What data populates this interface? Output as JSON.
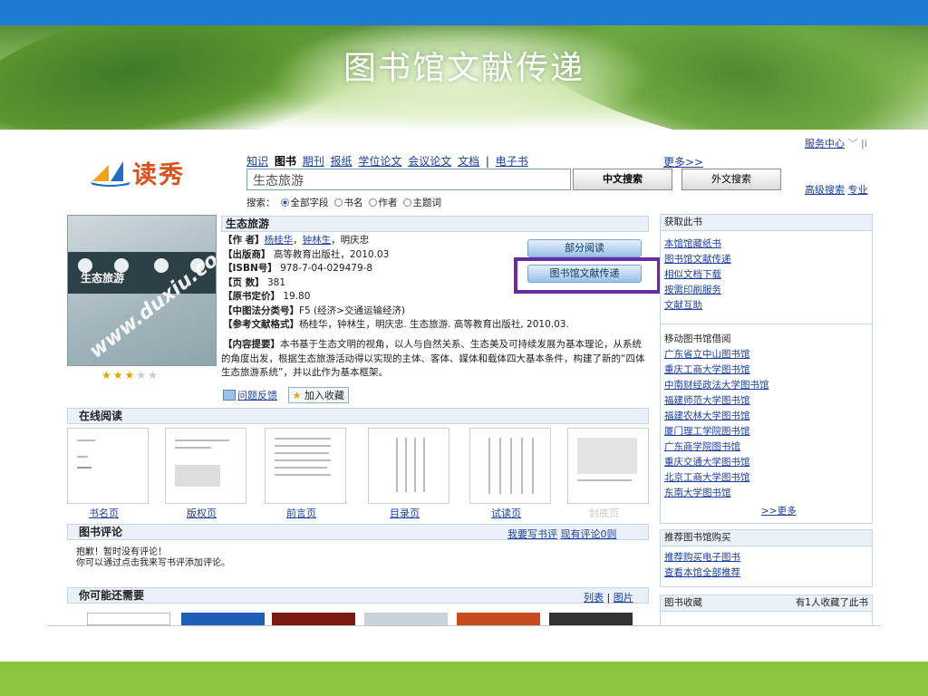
{
  "slide": {
    "title": "图书馆文献传递"
  },
  "header": {
    "logo_text": "读秀",
    "service_center": "服务中心",
    "service_extra": "|i",
    "nav": [
      "知识",
      "图书",
      "期刊",
      "报纸",
      "学位论文",
      "会议论文",
      "文档",
      "电子书"
    ],
    "nav_sep": "|",
    "more": "更多>>",
    "search_value": "生态旅游",
    "cn_search": "中文搜索",
    "foreign_search": "外文搜索",
    "advanced_search": "高级搜索",
    "professional_search": "专业",
    "search_label": "搜索：",
    "radio_options": [
      "全部字段",
      "书名",
      "作者",
      "主题词"
    ],
    "radio_selected": "全部字段"
  },
  "book": {
    "title": "生态旅游",
    "cover_title": "生态旅游",
    "cover_watermark": "www.duxiu.com",
    "author_label": "【作  者】",
    "authors": [
      "杨桂华",
      "钟林生"
    ],
    "author_rest": "，明庆忠",
    "publisher_label": "【出版商】",
    "publisher": "高等教育出版社，2010.03",
    "isbn_label": "【ISBN号】",
    "isbn": "978-7-04-029479-8",
    "pages_label": "【页  数】",
    "pages": "381",
    "price_label": "【原书定价】",
    "price": "19.80",
    "clc_label": "【中图法分类号】",
    "clc": "F5 (经济>交通运输经济)",
    "ref_label": "【参考文献格式】",
    "ref": "杨桂华，钟林生，明庆忠. 生态旅游. 高等教育出版社, 2010.03.",
    "summary_label": "【内容提要】",
    "summary": "本书基于生态文明的视角，以人与自然关系、生态美及可持续发展为基本理论，从系统的角度出发，根据生态旅游活动得以实现的主体、客体、媒体和载体四大基本条件，构建了新的“四体生态旅游系统”，并以此作为基本框架。",
    "rating": 3,
    "partial_read": "部分阅读",
    "doc_delivery": "图书馆文献传递",
    "feedback": "问题反馈",
    "add_fav": "加入收藏"
  },
  "online_read": {
    "heading": "在线阅读",
    "thumbs": [
      "书名页",
      "版权页",
      "前言页",
      "目录页",
      "试读页",
      "封底页"
    ]
  },
  "reviews": {
    "heading": "图书评论",
    "write": "我要写书评",
    "count": "现有评论0则",
    "empty_line1": "抱歉！暂时没有评论！",
    "empty_line2": "你可以通过点击我来写书评添加评论。"
  },
  "maybe": {
    "heading": "你可能还需要",
    "list": "列表",
    "sep": "|",
    "image": "图片"
  },
  "right": {
    "get_heading": "获取此书",
    "get_items": [
      "本馆馆藏纸书",
      "图书馆文献传递",
      "相似文档下载",
      "按需印刷服务",
      "文献互助"
    ],
    "borrow_heading": "移动图书馆借阅",
    "libraries": [
      "广东省立中山图书馆",
      "重庆工商大学图书馆",
      "中南财经政法大学图书馆",
      "福建师范大学图书馆",
      "福建农林大学图书馆",
      "厦门理工学院图书馆",
      "广东商学院图书馆",
      "重庆交通大学图书馆",
      "北京工商大学图书馆",
      "东南大学图书馆"
    ],
    "more": ">>更多",
    "recommend_heading": "推荐图书馆购买",
    "recommend_items": [
      "推荐购买电子图书",
      "查看本馆全部推荐"
    ],
    "collect_heading": "图书收藏",
    "collect_count": "有1人收藏了此书"
  },
  "colors": {
    "top_bar": "#1f7ad2",
    "bottom_bar": "#8cc63f",
    "highlight": "#6a2aa0",
    "link": "#1a3fa0"
  }
}
